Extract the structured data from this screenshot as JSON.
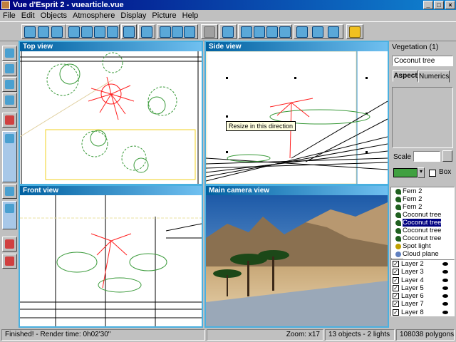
{
  "window": {
    "title": "Vue d'Esprit 2 - vuearticle.vue"
  },
  "menu": [
    "File",
    "Edit",
    "Objects",
    "Atmosphere",
    "Display",
    "Picture",
    "Help"
  ],
  "views": {
    "top": "Top view",
    "side": "Side view",
    "front": "Front view",
    "camera": "Main camera view"
  },
  "tooltip": "Resize in this direction",
  "panel": {
    "header": "Vegetation (1)",
    "name_value": "Coconut tree",
    "tab_aspect": "Aspect",
    "tab_numerics": "Numerics",
    "scale_label": "Scale",
    "box_label": "Box",
    "swatch_color": "#40a040"
  },
  "tree_items": [
    {
      "label": "Fern 2",
      "selected": false
    },
    {
      "label": "Fern 2",
      "selected": false
    },
    {
      "label": "Fern 2",
      "selected": false
    },
    {
      "label": "Coconut tree",
      "selected": false
    },
    {
      "label": "Coconut tree",
      "selected": true
    },
    {
      "label": "Coconut tree",
      "selected": false
    },
    {
      "label": "Coconut tree",
      "selected": false
    },
    {
      "label": "Spot light",
      "selected": false
    },
    {
      "label": "Cloud plane",
      "selected": false
    }
  ],
  "layers": [
    "Layer 2",
    "Layer 3",
    "Layer 4",
    "Layer 5",
    "Layer 6",
    "Layer 7",
    "Layer 8"
  ],
  "status": {
    "render": "Finished! - Render time: 0h02'30\"",
    "zoom": "Zoom: x17",
    "objects": "13 objects - 2 lights",
    "polygons": "108038 polygons"
  }
}
